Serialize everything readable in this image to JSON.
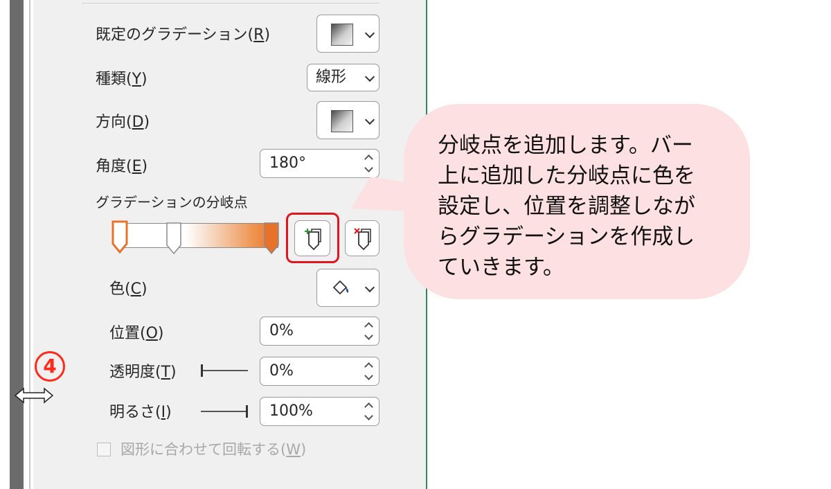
{
  "format_panel": {
    "preset_gradient": {
      "label": "既定のグラデーション(",
      "key": "R",
      "suffix": ")"
    },
    "type": {
      "label": "種類(",
      "key": "Y",
      "suffix": ")",
      "value": "線形"
    },
    "direction": {
      "label": "方向(",
      "key": "D",
      "suffix": ")"
    },
    "angle": {
      "label": "角度(",
      "key": "E",
      "suffix": ")",
      "value": "180°"
    },
    "stops_label": "グラデーションの分岐点",
    "color": {
      "label": "色(",
      "key": "C",
      "suffix": ")"
    },
    "position": {
      "label": "位置(",
      "key": "O",
      "suffix": ")",
      "value": "0%"
    },
    "transparency": {
      "label": "透明度(",
      "key": "T",
      "suffix": ")",
      "value": "0%",
      "slider_fraction": 0.0
    },
    "brightness": {
      "label": "明るさ(",
      "key": "I",
      "suffix": ")",
      "value": "100%",
      "slider_fraction": 1.0
    },
    "rotate_with_shape": {
      "label": "図形に合わせて回転する(",
      "key": "W",
      "suffix": ")",
      "checked": false,
      "disabled": true
    }
  },
  "gradient_colors": {
    "start": "#ffffff",
    "end": "#e8722a",
    "selected_stop": "#e8722a"
  },
  "callout": {
    "lines": [
      "分岐点を追加します。バー",
      "上に追加した分岐点に色を",
      "設定し、位置を調整しなが",
      "らグラデーションを作成し",
      "ていきます。"
    ],
    "background": "#fde0e1"
  },
  "step_number": "4",
  "icons": {
    "add_stop": "add-gradient-stop-icon",
    "remove_stop": "remove-gradient-stop-icon",
    "fill": "paint-bucket-icon",
    "resize": "resize-horizontal-cursor-icon"
  },
  "accent_colors": {
    "highlight": "#e0161f",
    "step": "#ff2a1a"
  }
}
